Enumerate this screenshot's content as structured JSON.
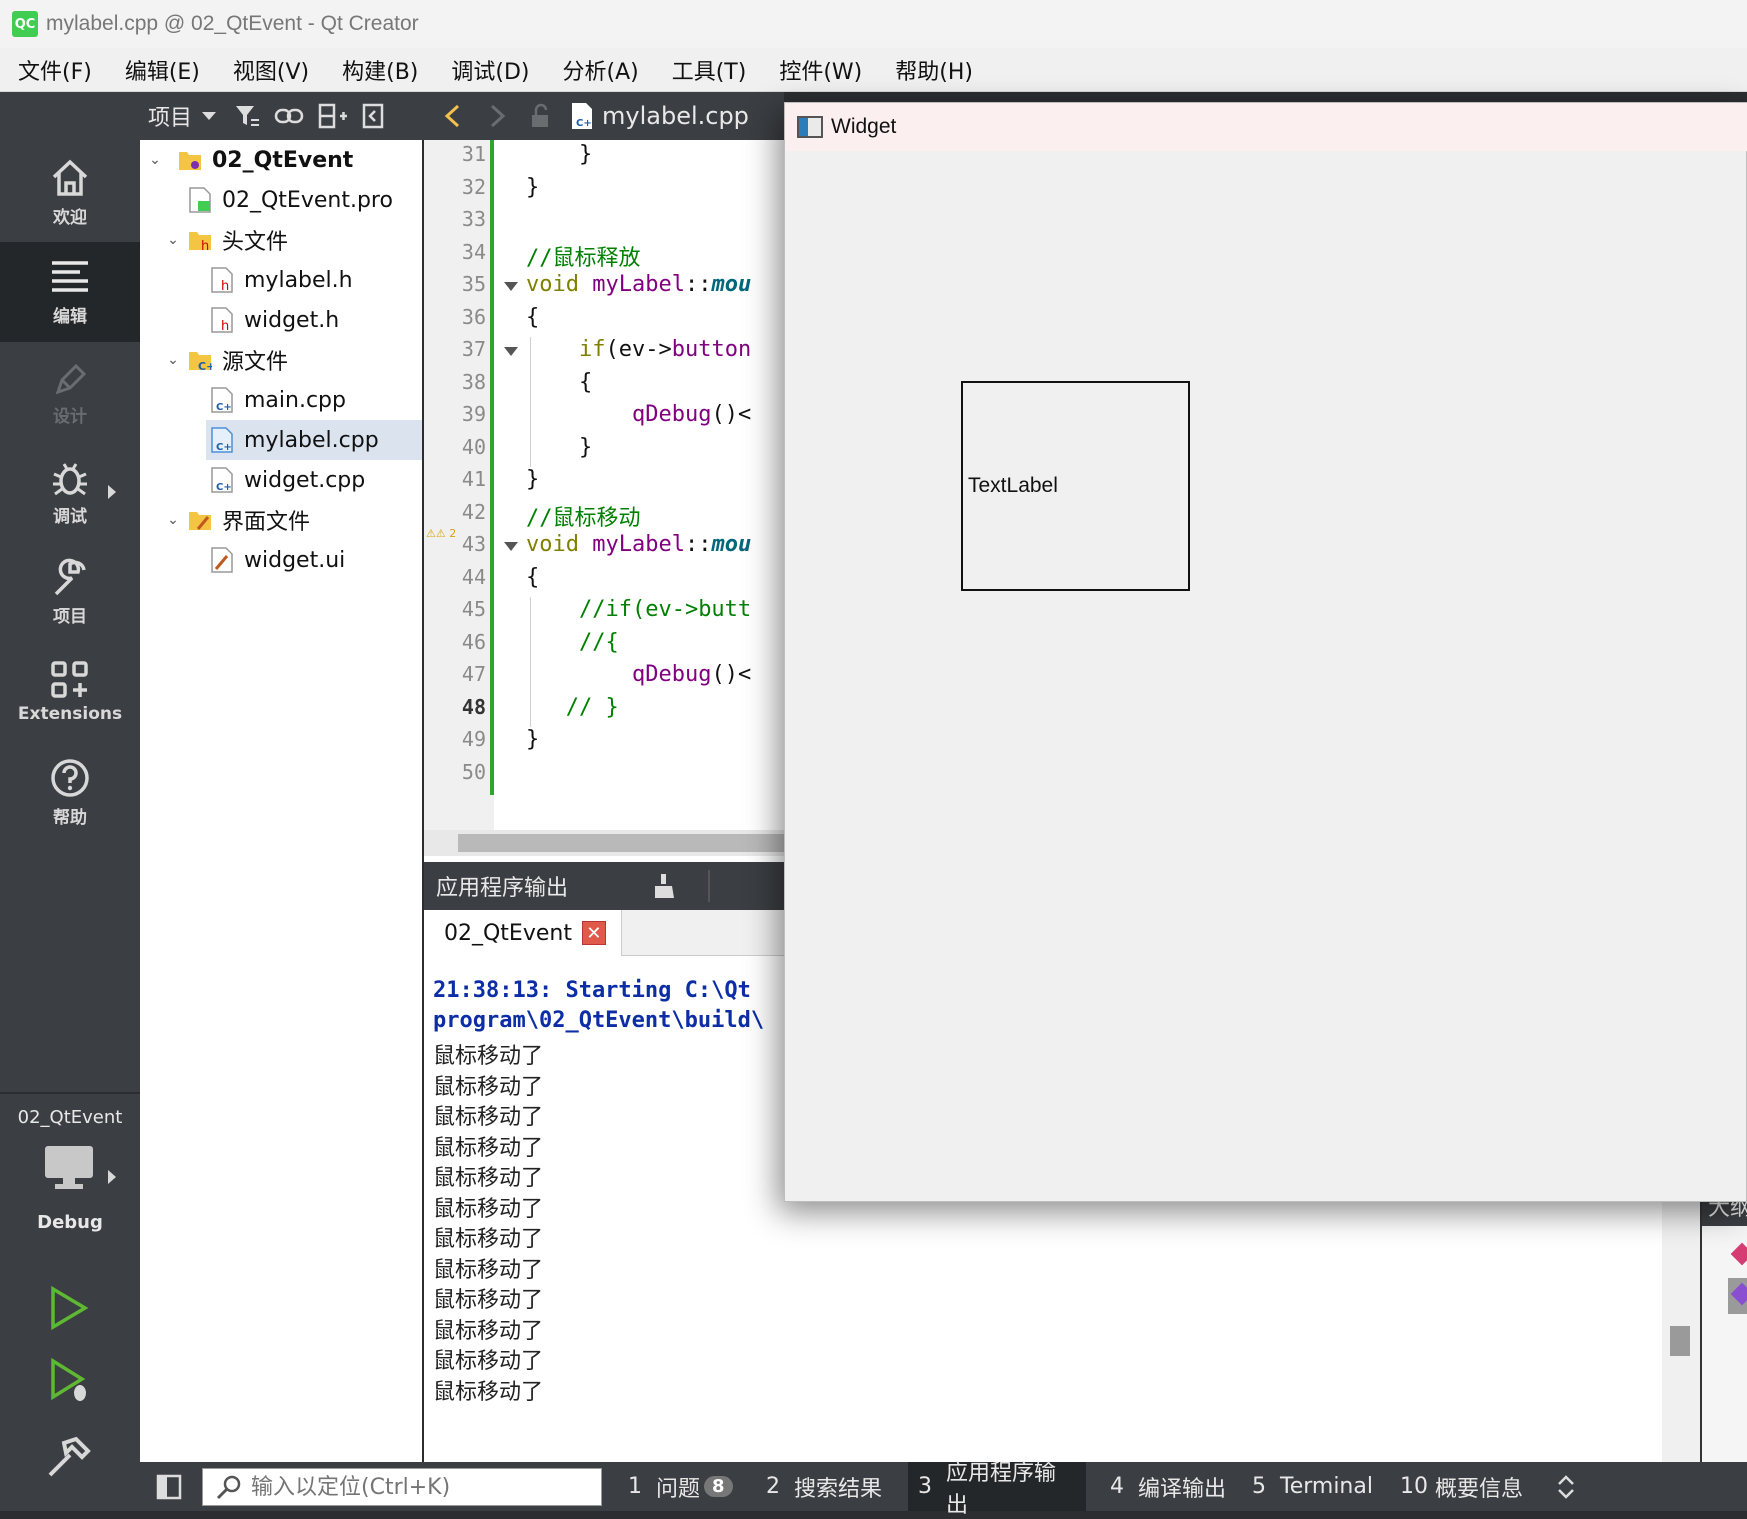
{
  "window": {
    "title": "mylabel.cpp @ 02_QtEvent - Qt Creator",
    "app_icon": "QC"
  },
  "menu": [
    "文件(F)",
    "编辑(E)",
    "视图(V)",
    "构建(B)",
    "调试(D)",
    "分析(A)",
    "工具(T)",
    "控件(W)",
    "帮助(H)"
  ],
  "modes": [
    {
      "label": "欢迎",
      "icon": "home-icon"
    },
    {
      "label": "编辑",
      "icon": "edit-lines-icon",
      "active": true
    },
    {
      "label": "设计",
      "icon": "pen-icon",
      "disabled": true
    },
    {
      "label": "调试",
      "icon": "bug-icon"
    },
    {
      "label": "项目",
      "icon": "wrench-icon"
    },
    {
      "label": "Extensions",
      "icon": "extensions-icon"
    },
    {
      "label": "帮助",
      "icon": "help-icon"
    }
  ],
  "kit": {
    "project": "02_QtEvent",
    "config": "Debug"
  },
  "project_panel": {
    "label": "项目",
    "tree": [
      {
        "label": "02_QtEvent",
        "level": 0,
        "expanded": true,
        "bold": true,
        "icon": "project-folder-icon"
      },
      {
        "label": "02_QtEvent.pro",
        "level": 1,
        "icon": "pro-file-icon"
      },
      {
        "label": "头文件",
        "level": 1,
        "expanded": true,
        "icon": "header-folder-icon"
      },
      {
        "label": "mylabel.h",
        "level": 2,
        "icon": "header-file-icon"
      },
      {
        "label": "widget.h",
        "level": 2,
        "icon": "header-file-icon"
      },
      {
        "label": "源文件",
        "level": 1,
        "expanded": true,
        "icon": "source-folder-icon"
      },
      {
        "label": "main.cpp",
        "level": 2,
        "icon": "cpp-file-icon"
      },
      {
        "label": "mylabel.cpp",
        "level": 2,
        "icon": "cpp-file-icon",
        "selected": true
      },
      {
        "label": "widget.cpp",
        "level": 2,
        "icon": "cpp-file-icon"
      },
      {
        "label": "界面文件",
        "level": 1,
        "expanded": true,
        "icon": "form-folder-icon"
      },
      {
        "label": "widget.ui",
        "level": 2,
        "icon": "ui-file-icon"
      }
    ]
  },
  "editor": {
    "file": "mylabel.cpp",
    "current_line": "48",
    "warning_count": "2",
    "lines": [
      {
        "n": "31",
        "html": "    }"
      },
      {
        "n": "32",
        "html": "}"
      },
      {
        "n": "33",
        "html": ""
      },
      {
        "n": "34",
        "cm": "//鼠标释放"
      },
      {
        "n": "35",
        "kw": "void ",
        "ty": "myLabel",
        "op": "::",
        "fn": "mou",
        "fold": true
      },
      {
        "n": "36",
        "html": "{"
      },
      {
        "n": "37",
        "pre": "    ",
        "kw": "if",
        "rest": "(ev->",
        "ty": "button",
        "fold": true
      },
      {
        "n": "38",
        "html": "    {"
      },
      {
        "n": "39",
        "pre": "        ",
        "fncall": "qDebug",
        "rest": "()<"
      },
      {
        "n": "40",
        "html": "    }"
      },
      {
        "n": "41",
        "html": "}"
      },
      {
        "n": "42",
        "cm": "//鼠标移动"
      },
      {
        "n": "43",
        "kw": "void ",
        "ty": "myLabel",
        "op": "::",
        "fn": "mou",
        "fold": true,
        "warn": true
      },
      {
        "n": "44",
        "html": "{"
      },
      {
        "n": "45",
        "pre": "    ",
        "cm": "//if(ev->butt"
      },
      {
        "n": "46",
        "pre": "    ",
        "cm": "//{"
      },
      {
        "n": "47",
        "pre": "        ",
        "fncall": "qDebug",
        "rest": "()<"
      },
      {
        "n": "48",
        "pre": "   ",
        "cm": "// }"
      },
      {
        "n": "49",
        "html": "}"
      },
      {
        "n": "50",
        "html": ""
      }
    ]
  },
  "output": {
    "title": "应用程序输出",
    "tab": "02_QtEvent",
    "run_lines": [
      "21:38:13: Starting C:\\Qt",
      "program\\02_QtEvent\\build\\"
    ],
    "messages": [
      "鼠标移动了",
      "鼠标移动了",
      "鼠标移动了",
      "鼠标移动了",
      "鼠标移动了",
      "鼠标移动了",
      "鼠标移动了",
      "鼠标移动了",
      "鼠标移动了",
      "鼠标移动了",
      "鼠标移动了",
      "鼠标移动了"
    ]
  },
  "right_pane": {
    "label": "大纲"
  },
  "statusbar": {
    "search_placeholder": "输入以定位(Ctrl+K)",
    "tabs": [
      {
        "num": "1",
        "label": "问题",
        "badge": "8"
      },
      {
        "num": "2",
        "label": "搜索结果"
      },
      {
        "num": "3",
        "label": "应用程序输出",
        "active": true
      },
      {
        "num": "4",
        "label": "编译输出"
      },
      {
        "num": "5",
        "label": "Terminal"
      },
      {
        "num": "10",
        "label": "概要信息"
      }
    ]
  },
  "widget_window": {
    "title": "Widget",
    "label_text": "TextLabel"
  },
  "colors": {
    "sidebar": "#3b3e42",
    "active_mode": "#24272a",
    "keyword": "#808000",
    "type": "#800080",
    "comment": "#008000",
    "run_text": "#0d2da6"
  }
}
